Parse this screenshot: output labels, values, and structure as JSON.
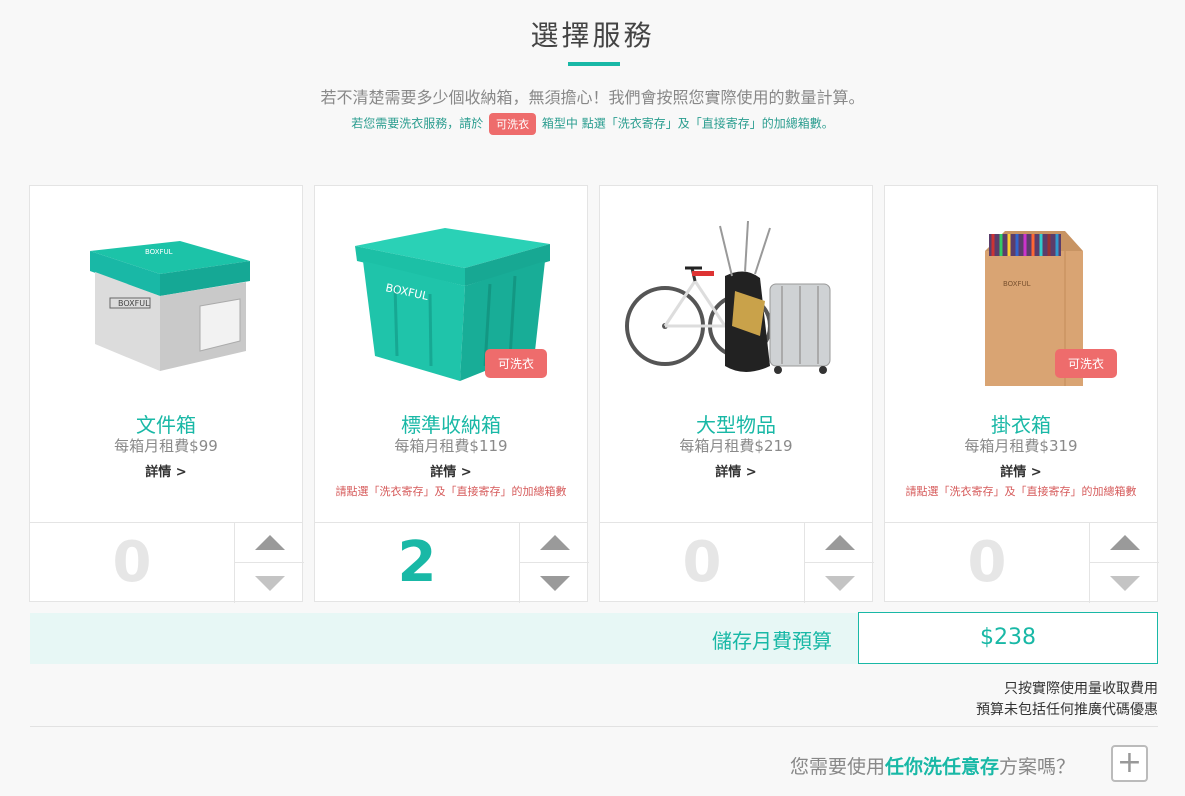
{
  "header": {
    "title": "選擇服務",
    "subtitle": "若不清楚需要多少個收納箱，無須擔心！我們會按照您實際使用的數量計算。",
    "note_prefix": "若您需要洗衣服務，請於",
    "note_pill": "可洗衣",
    "note_suffix": "箱型中 點選「洗衣寄存」及「直接寄存」的加總箱數。"
  },
  "cards": [
    {
      "name": "文件箱",
      "price": "每箱月租費$99",
      "details": "詳情 >",
      "hint": "",
      "badge": "",
      "qty": "0",
      "image": "document-box"
    },
    {
      "name": "標準收納箱",
      "price": "每箱月租費$119",
      "details": "詳情 >",
      "hint": "請點選「洗衣寄存」及「直接寄存」的加總箱數",
      "badge": "可洗衣",
      "qty": "2",
      "image": "plastic-storage-box"
    },
    {
      "name": "大型物品",
      "price": "每箱月租費$219",
      "details": "詳情 >",
      "hint": "",
      "badge": "",
      "qty": "0",
      "image": "bicycle-golf-bag-suitcase"
    },
    {
      "name": "掛衣箱",
      "price": "每箱月租費$319",
      "details": "詳情 >",
      "hint": "請點選「洗衣寄存」及「直接寄存」的加總箱數",
      "badge": "可洗衣",
      "qty": "0",
      "image": "wardrobe-box"
    }
  ],
  "budget": {
    "label": "儲存月費預算",
    "value": "$238"
  },
  "fine_print": [
    "只按實際使用量收取費用",
    "預算未包括任何推廣代碼優惠"
  ],
  "plan": {
    "prefix": "您需要使用",
    "highlight": "任你洗任意存",
    "suffix": "方案嗎？",
    "button": "+"
  },
  "colors": {
    "accent": "#19b8a6",
    "badge": "#ee6c6c",
    "hint": "#d65b5b"
  }
}
